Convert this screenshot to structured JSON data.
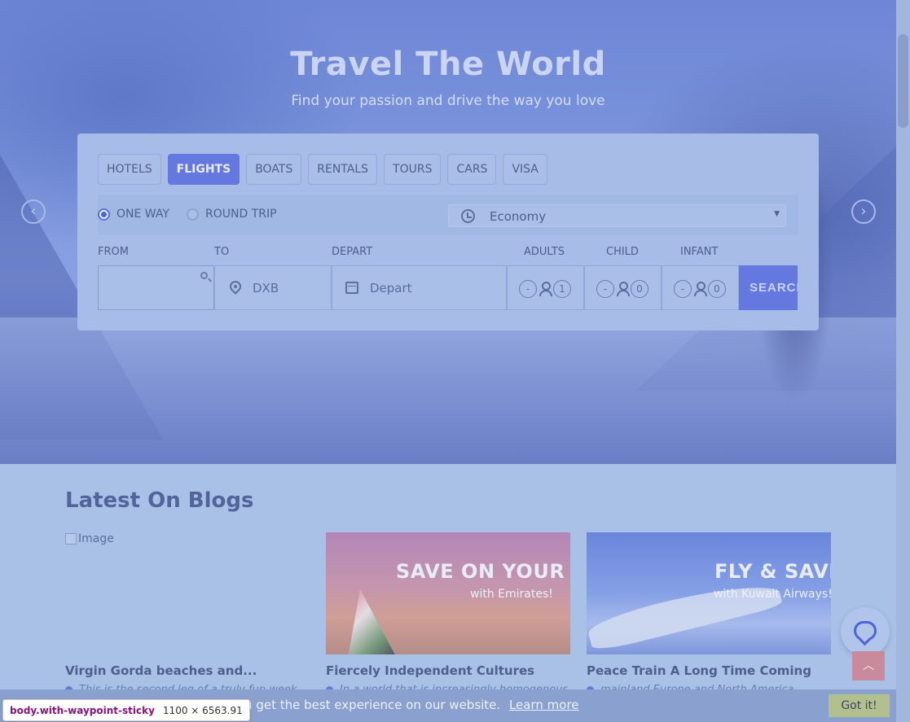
{
  "hero": {
    "title": "Travel The World",
    "subtitle": "Find your passion and drive the way you love",
    "prev_icon": "chevron-left-icon",
    "next_icon": "chevron-right-icon"
  },
  "search": {
    "tabs": [
      {
        "label": "HOTELS",
        "active": false
      },
      {
        "label": "FLIGHTS",
        "active": true
      },
      {
        "label": "BOATS",
        "active": false
      },
      {
        "label": "RENTALS",
        "active": false
      },
      {
        "label": "TOURS",
        "active": false
      },
      {
        "label": "CARS",
        "active": false
      },
      {
        "label": "VISA",
        "active": false
      }
    ],
    "trip_type": {
      "one_way": "ONE WAY",
      "round_trip": "ROUND TRIP",
      "selected": "one_way"
    },
    "cabin_class": "Economy",
    "labels": {
      "from": "FROM",
      "to": "TO",
      "depart": "DEPART",
      "adults": "ADULTS",
      "child": "CHILD",
      "infant": "INFANT"
    },
    "from_value": "",
    "to_value": "DXB",
    "depart_placeholder": "Depart",
    "adults": {
      "minus": "-",
      "count": "1"
    },
    "child": {
      "minus": "-",
      "count": "0"
    },
    "infant": {
      "minus": "-",
      "count": "0"
    },
    "search_label": "SEARCH"
  },
  "blog": {
    "heading": "Latest On Blogs",
    "cards": [
      {
        "image_alt": "Image",
        "title": "Virgin Gorda beaches and...",
        "excerpt": "This is the second leg of a truly fun week"
      },
      {
        "promo_big": "SAVE ON YOUR FL",
        "promo_small": "with Emirates!",
        "title": "Fiercely Independent Cultures",
        "excerpt": "In a world that is increasingly homogenous"
      },
      {
        "promo_big": "FLY & SAVE",
        "promo_small": "with Kuwait Airways!",
        "title": "Peace Train A Long Time Coming",
        "excerpt": "mainland Europe and North America"
      }
    ]
  },
  "cookie": {
    "text": "you get the best experience on our website.",
    "link": "Learn more",
    "button": "Got it!"
  },
  "floating": {
    "chat_icon": "chat-bubble-icon",
    "top_icon": "chevron-up-icon",
    "top_glyph": "︿"
  },
  "devtools_tooltip": {
    "selector": "body.with-waypoint-sticky",
    "dimensions": "1100 × 6563.91"
  }
}
